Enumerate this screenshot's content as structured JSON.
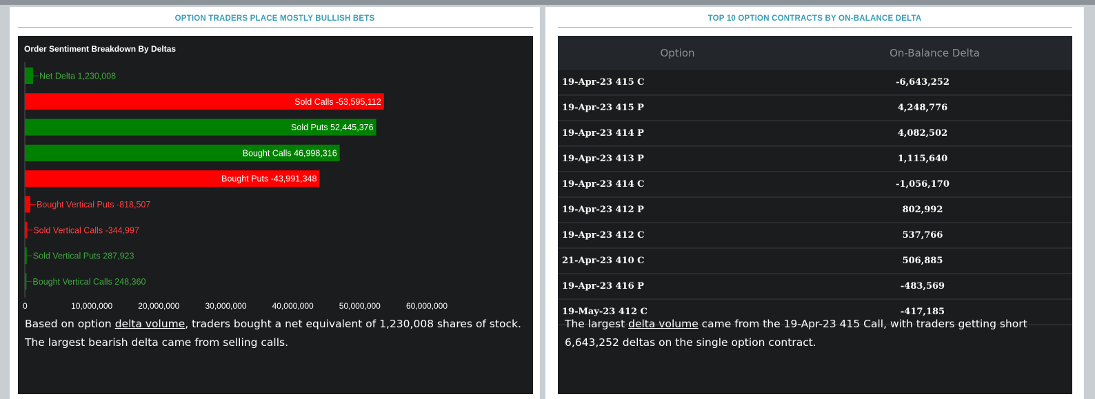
{
  "left_panel": {
    "title": "OPTION TRADERS PLACE MOSTLY BULLISH BETS",
    "description": {
      "prefix": "Based on option ",
      "link": "delta volume",
      "suffix": ", traders bought a net equivalent of 1,230,008 shares of stock. The largest bearish delta came from selling calls."
    }
  },
  "right_panel": {
    "title": "TOP 10 OPTION CONTRACTS BY ON-BALANCE DELTA",
    "table": {
      "headers": [
        "Option",
        "On-Balance Delta"
      ],
      "rows": [
        [
          "19-Apr-23 415 C",
          "-6,643,252"
        ],
        [
          "19-Apr-23 415 P",
          "4,248,776"
        ],
        [
          "19-Apr-23 414 P",
          "4,082,502"
        ],
        [
          "19-Apr-23 413 P",
          "1,115,640"
        ],
        [
          "19-Apr-23 414 C",
          "-1,056,170"
        ],
        [
          "19-Apr-23 412 P",
          "802,992"
        ],
        [
          "19-Apr-23 412 C",
          "537,766"
        ],
        [
          "21-Apr-23 410 C",
          "506,885"
        ],
        [
          "19-Apr-23 416 P",
          "-483,569"
        ],
        [
          "19-May-23 412 C",
          "-417,185"
        ]
      ]
    },
    "description": {
      "prefix": "The largest ",
      "link": "delta volume",
      "suffix": " came from the 19-Apr-23 415 Call, with traders getting short 6,643,252 deltas on the single option contract."
    }
  },
  "colors": {
    "bullish": "#008000",
    "bearish": "#ff0000",
    "accent": "#3a9eb5"
  },
  "chart_data": {
    "type": "bar",
    "orientation": "horizontal",
    "title": "Order Sentiment Breakdown By Deltas",
    "categories": [
      "Net Delta",
      "Sold Calls",
      "Sold Puts",
      "Bought Calls",
      "Bought Puts",
      "Bought Vertical Puts",
      "Sold Vertical Calls",
      "Sold Vertical Puts",
      "Bought Vertical Calls"
    ],
    "values": [
      1230008,
      -53595112,
      52445376,
      46998316,
      -43991348,
      -818507,
      -344997,
      287923,
      248360
    ],
    "labels": [
      "Net Delta 1,230,008",
      "Sold Calls -53,595,112",
      "Sold Puts 52,445,376",
      "Bought Calls 46,998,316",
      "Bought Puts -43,991,348",
      "Bought Vertical Puts -818,507",
      "Sold Vertical Calls -344,997",
      "Sold Vertical Puts 287,923",
      "Bought Vertical Calls 248,360"
    ],
    "xticks": [
      "0",
      "10,000,000",
      "20,000,000",
      "30,000,000",
      "40,000,000",
      "50,000,000",
      "60,000,000"
    ],
    "xlim": [
      0,
      60000000
    ],
    "grid": false,
    "legend": "none"
  }
}
